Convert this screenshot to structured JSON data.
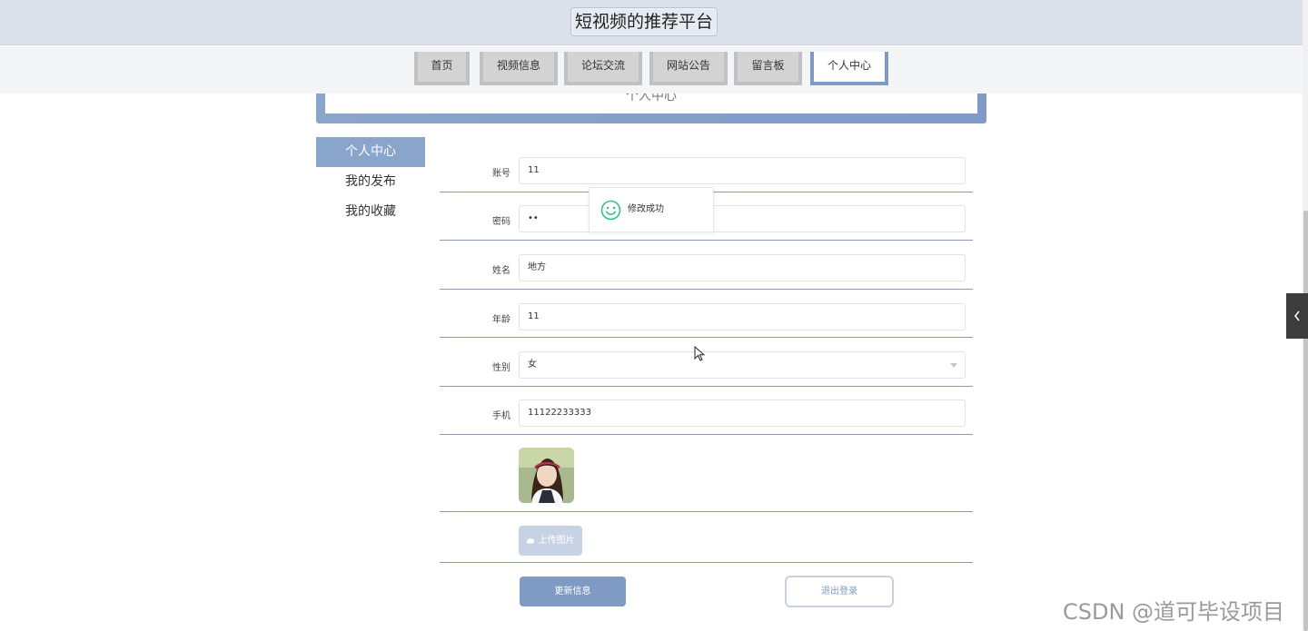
{
  "header": {
    "title": "短视频的推荐平台"
  },
  "nav": {
    "items": [
      {
        "label": "首页"
      },
      {
        "label": "视频信息"
      },
      {
        "label": "论坛交流"
      },
      {
        "label": "网站公告"
      },
      {
        "label": "留言板"
      },
      {
        "label": "个人中心"
      }
    ],
    "active_index": 5
  },
  "banner": {
    "title": "个人中心"
  },
  "sidebar": {
    "items": [
      {
        "label": "个人中心"
      },
      {
        "label": "我的发布"
      },
      {
        "label": "我的收藏"
      }
    ]
  },
  "form": {
    "account": {
      "label": "账号",
      "value": "11"
    },
    "password": {
      "label": "密码",
      "value": "••"
    },
    "name": {
      "label": "姓名",
      "value": "地方"
    },
    "age": {
      "label": "年龄",
      "value": "11"
    },
    "gender": {
      "label": "性别",
      "value": "女"
    },
    "phone": {
      "label": "手机",
      "value": "11122233333"
    },
    "upload_label": "上传图片"
  },
  "actions": {
    "update": "更新信息",
    "logout": "退出登录"
  },
  "toast": {
    "message": "修改成功"
  },
  "watermark": "CSDN @道可毕设项目",
  "colors": {
    "accent": "#7f9bc3",
    "toast_icon": "#35c08e"
  }
}
